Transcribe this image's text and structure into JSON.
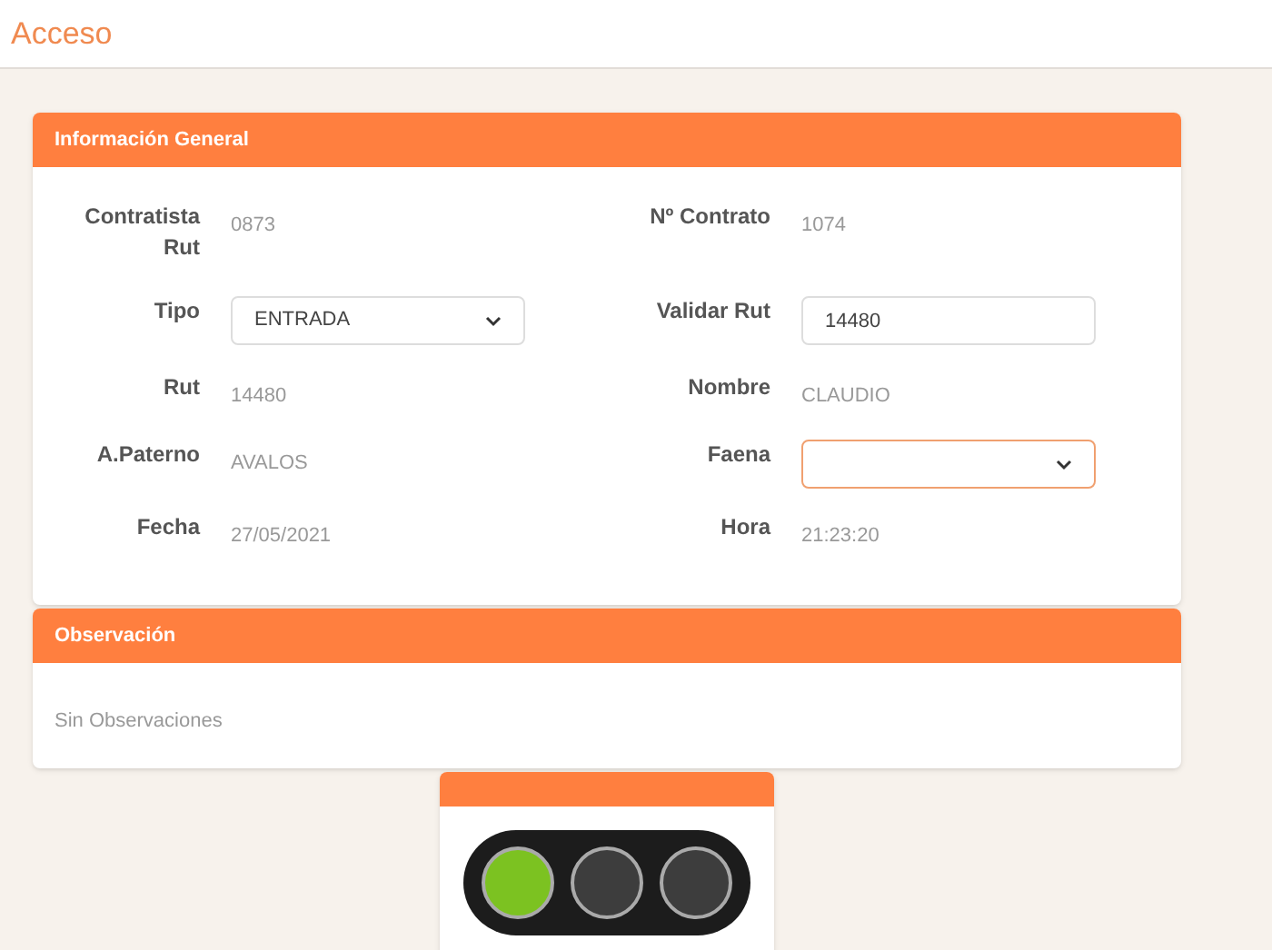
{
  "page_title": "Acceso",
  "general": {
    "title": "Información General",
    "rows": [
      [
        {
          "label": "Contratista Rut",
          "kind": "text",
          "value": "0873"
        },
        {
          "label": "Nº Contrato",
          "kind": "text",
          "value": "1074"
        }
      ],
      [
        {
          "label": "Tipo",
          "kind": "select",
          "value": "ENTRADA",
          "focused": false
        },
        {
          "label": "Validar Rut",
          "kind": "input",
          "value": "14480",
          "focused": false
        }
      ],
      [
        {
          "label": "Rut",
          "kind": "text",
          "value": "14480"
        },
        {
          "label": "Nombre",
          "kind": "text",
          "value": "CLAUDIO"
        }
      ],
      [
        {
          "label": "A.Paterno",
          "kind": "text",
          "value": "AVALOS"
        },
        {
          "label": "Faena",
          "kind": "select",
          "focused": true
        }
      ],
      [
        {
          "label": "Fecha",
          "kind": "text",
          "value": "27/05/2021"
        },
        {
          "label": "Hora",
          "kind": "text",
          "value": "21:23:20"
        }
      ]
    ]
  },
  "observation": {
    "title": "Observación",
    "text": "Sin Observaciones"
  },
  "traffic_light": {
    "lights": [
      {
        "on": true,
        "color": "#7cc221"
      },
      {
        "on": false
      },
      {
        "on": false
      }
    ]
  }
}
